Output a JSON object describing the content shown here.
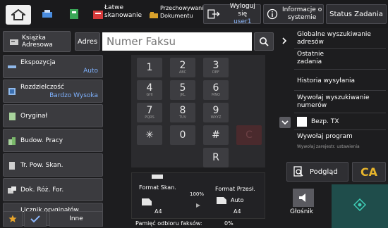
{
  "topbar": {
    "easy_scan": "Łatwe\nskanowanie",
    "doc_store": "Przechowywanie\nDokumentu",
    "logout": "Wyloguj się",
    "user": "user1",
    "system_info": "Informacje o\nsystemie",
    "job_status": "Status Zadania"
  },
  "address": {
    "book_label": "Książka\nAdresowa",
    "addr_label": "Adres",
    "fax_placeholder": "Numer Faksu"
  },
  "left": [
    {
      "label": "Ekspozycja",
      "value": "Auto"
    },
    {
      "label": "Rozdzielczość",
      "value": "Bardzo Wysoka"
    },
    {
      "label": "Oryginał",
      "value": ""
    },
    {
      "label": "Budow. Pracy",
      "value": ""
    },
    {
      "label": "Tr. Pow. Skan.",
      "value": ""
    },
    {
      "label": "Dok. Róż. For.",
      "value": ""
    },
    {
      "label": "Licznik oryginałów",
      "value": ""
    }
  ],
  "bottom": {
    "other": "Inne"
  },
  "keypad": {
    "k1": "1",
    "k2": "2",
    "k2s": "ABC",
    "k3": "3",
    "k3s": "DEF",
    "k4": "4",
    "k4s": "GHI",
    "k5": "5",
    "k5s": "JKL",
    "k6": "6",
    "k6s": "MNO",
    "k7": "7",
    "k7s": "PQRS",
    "k8": "8",
    "k8s": "TUV",
    "k9": "9",
    "k9s": "WXYZ",
    "kstar": "✳",
    "k0": "0",
    "khash": "#",
    "kc": "C",
    "kr": "R"
  },
  "format": {
    "scan_label": "Format Skan.",
    "scan_size": "A4",
    "ratio": "100%",
    "send_label": "Format Przesł.",
    "send_auto": "Auto",
    "send_size": "A4",
    "memory": "Pamięć odbioru faksów:",
    "memory_pct": "0%"
  },
  "right": {
    "global_search": "Globalne wyszukiwanie\nadresów",
    "recent": "Ostatnie\nzadania",
    "history": "Historia wysyłania",
    "call_search": "Wywołaj wyszukiwanie\nnumerów",
    "bezp": "Bezp. TX",
    "call_program": "Wywołaj program",
    "call_settings": "Wywołaj zarejestr. ustawienia",
    "preview": "Podgląd",
    "ca": "CA",
    "speaker": "Głośnik"
  },
  "colors": {
    "accent": "#7fb2ff",
    "ca": "#e8b52c",
    "start": "#1f4d4b"
  }
}
